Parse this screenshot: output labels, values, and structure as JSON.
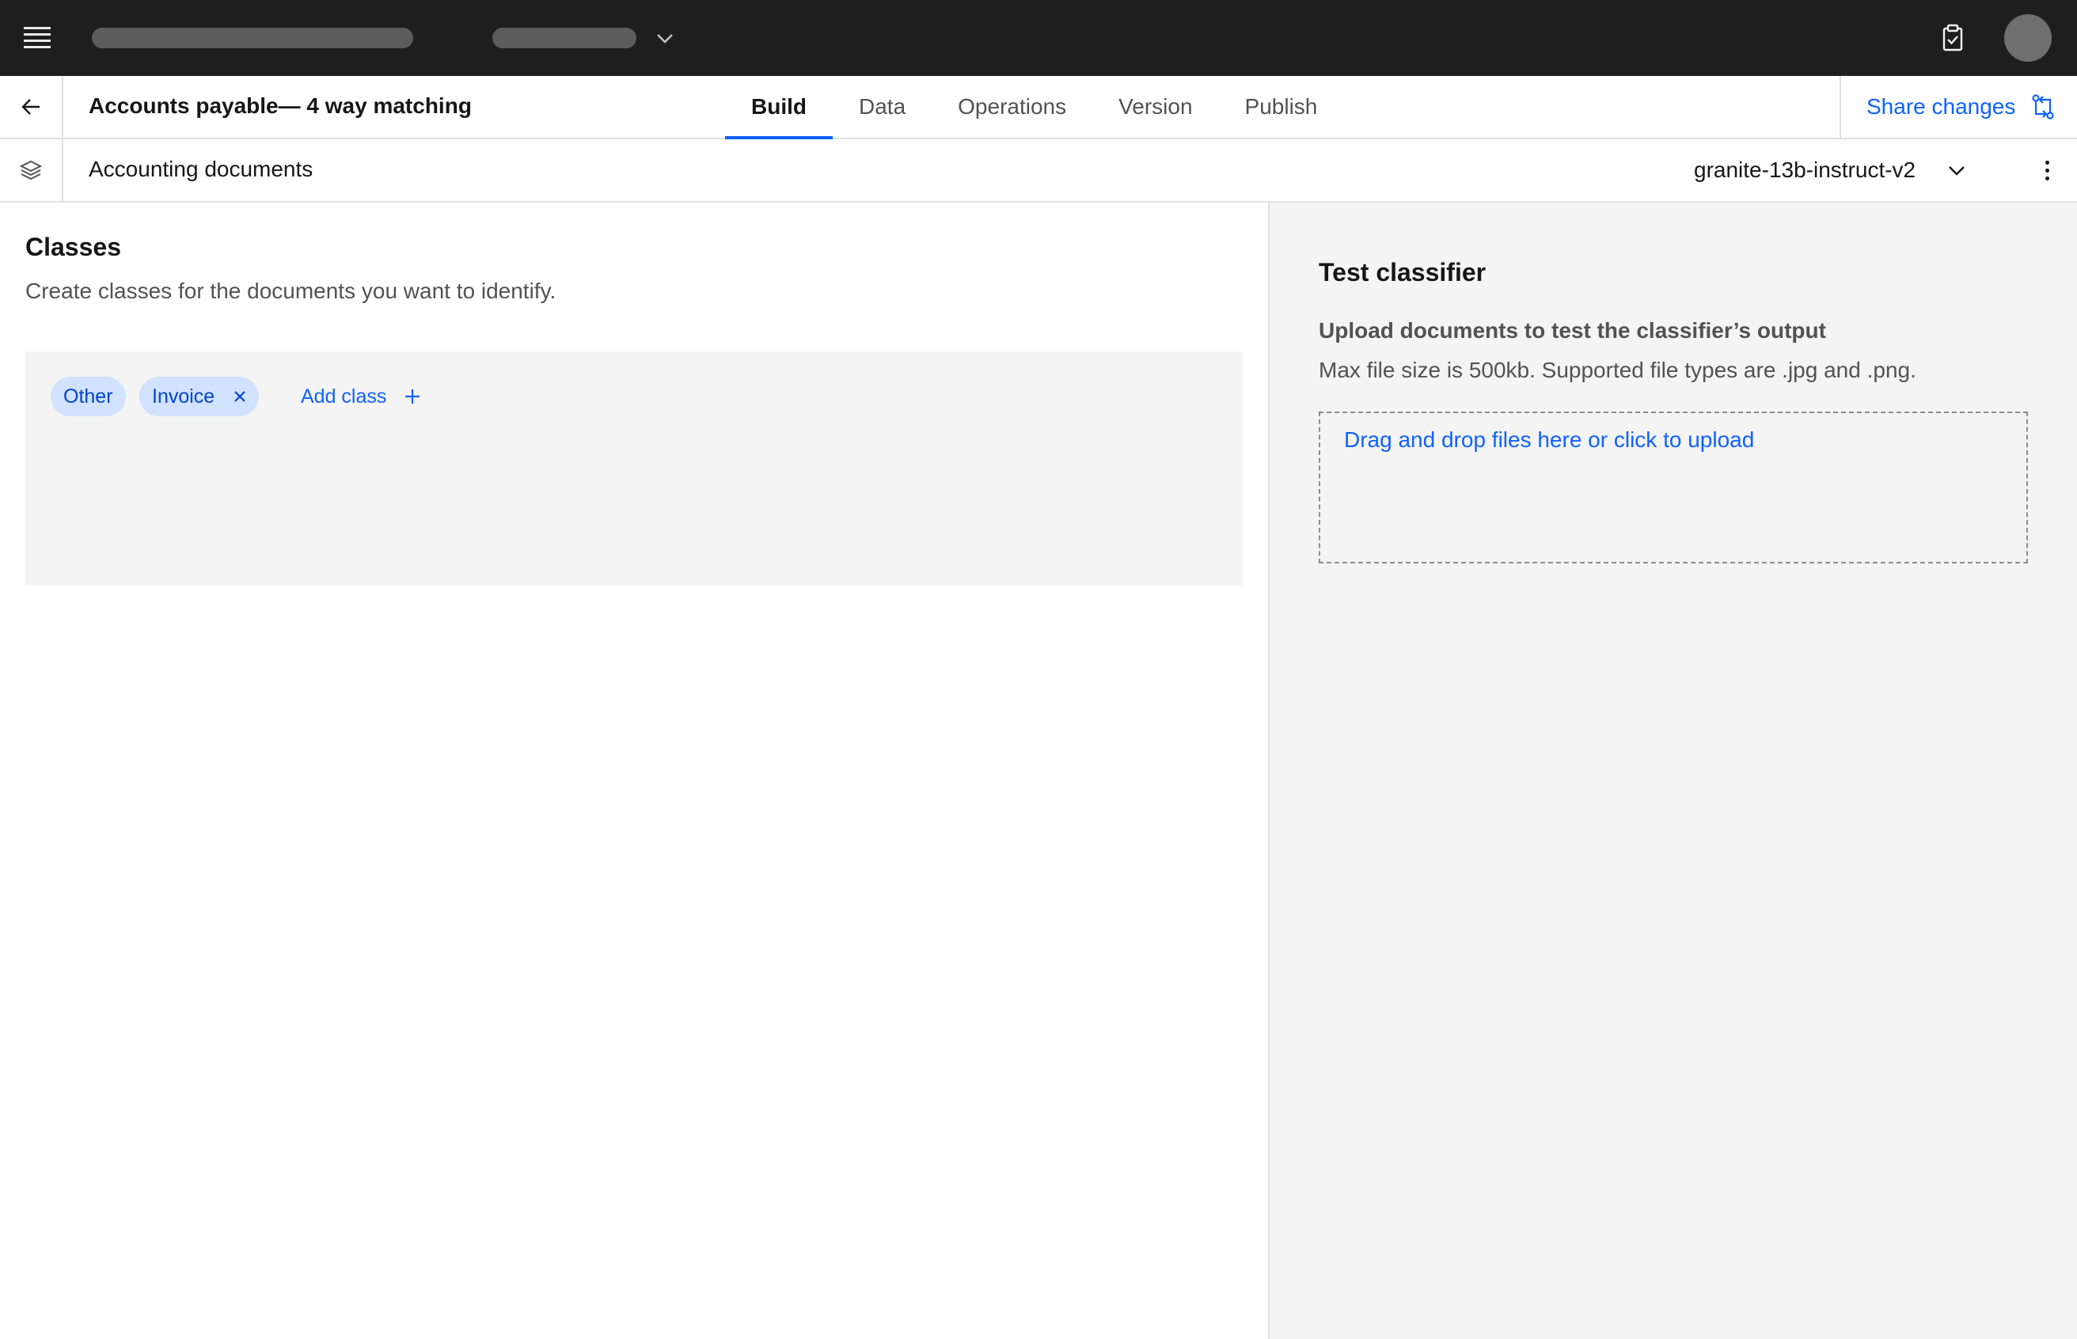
{
  "header": {
    "icons": {
      "menu": "hamburger-icon",
      "chevron": "chevron-down-icon",
      "notifications": "clipboard-check-icon",
      "user": "avatar"
    }
  },
  "project": {
    "title": "Accounts payable— 4 way matching",
    "tabs": [
      {
        "label": "Build",
        "active": true
      },
      {
        "label": "Data",
        "active": false
      },
      {
        "label": "Operations",
        "active": false
      },
      {
        "label": "Version",
        "active": false
      },
      {
        "label": "Publish",
        "active": false
      }
    ],
    "share_label": "Share changes",
    "share_icon": "share-changes-icon"
  },
  "subheader": {
    "title": "Accounting documents",
    "model": "granite-13b-instruct-v2"
  },
  "classes": {
    "heading": "Classes",
    "description": "Create classes for the documents you want to identify.",
    "tags": [
      {
        "label": "Other",
        "removable": false
      },
      {
        "label": "Invoice",
        "removable": true
      }
    ],
    "add_label": "Add class"
  },
  "test": {
    "heading": "Test classifier",
    "upload_heading": "Upload documents to test the classifier’s output",
    "upload_desc": "Max file size is 500kb. Supported file types are .jpg and .png.",
    "dropzone_label": "Drag and drop files here or click to upload"
  },
  "colors": {
    "accent": "#0f62fe",
    "topbar": "#1e1e1e",
    "tag_bg": "#d0e2ff",
    "tag_text": "#0043ce",
    "panel_bg": "#f4f4f4"
  }
}
